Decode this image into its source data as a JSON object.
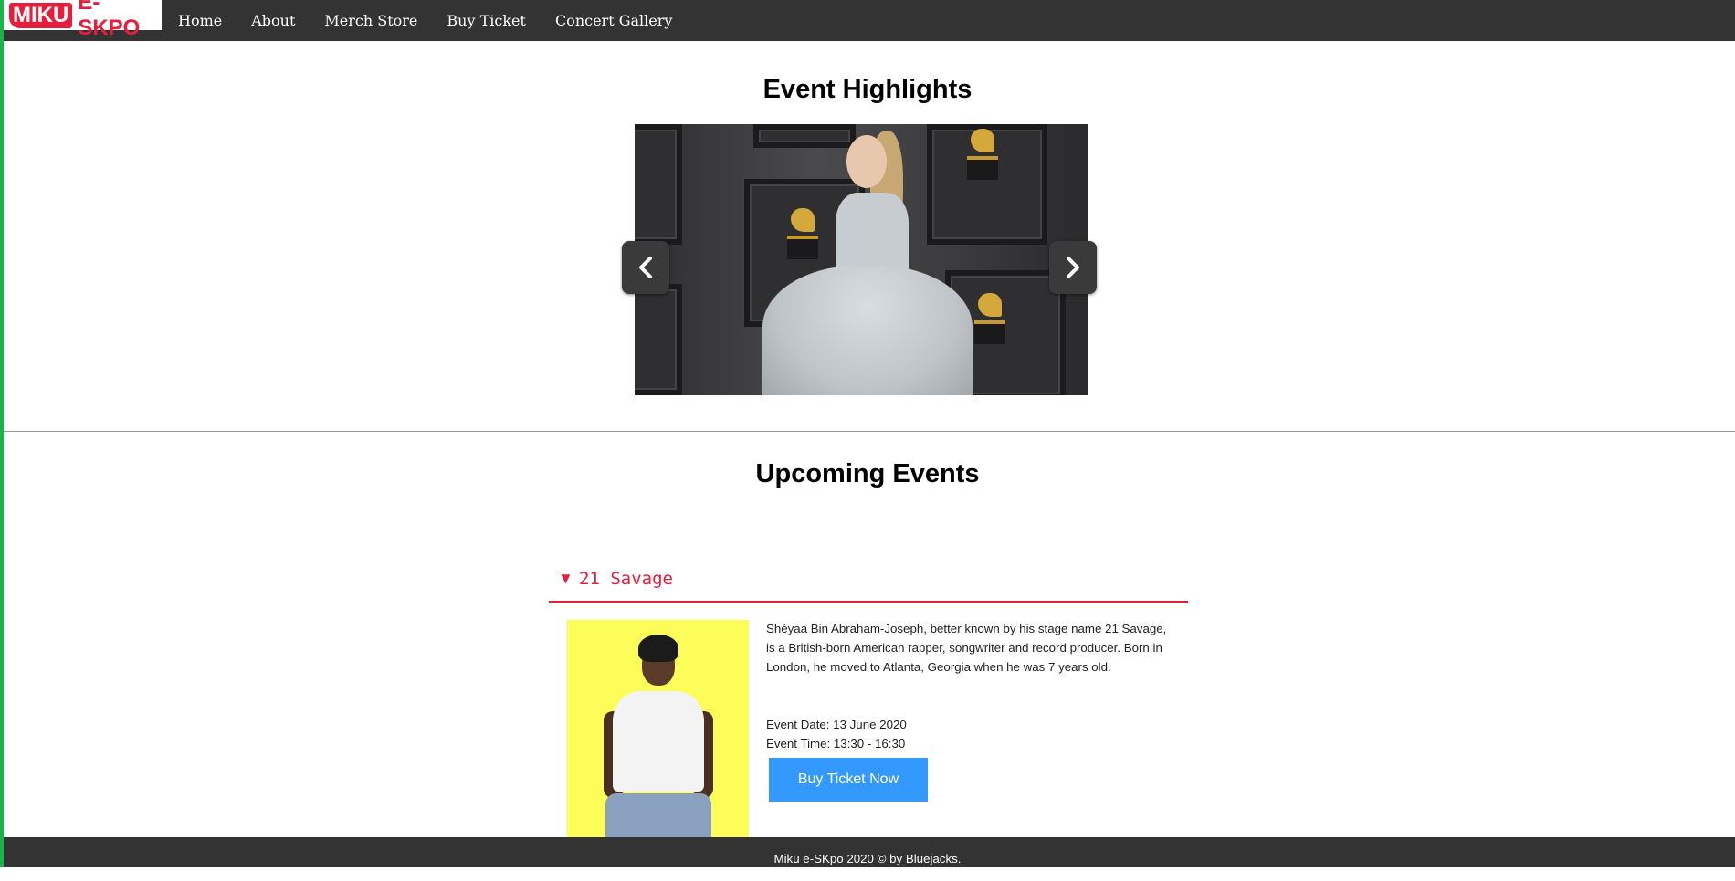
{
  "brand": {
    "logo_part1": "MIKU",
    "logo_part2": "E-SKPO"
  },
  "nav": {
    "items": [
      "Home",
      "About",
      "Merch Store",
      "Buy Ticket",
      "Concert Gallery"
    ]
  },
  "highlights": {
    "title": "Event Highlights"
  },
  "upcoming": {
    "title": "Upcoming Events",
    "event": {
      "name": "21 Savage",
      "description": "Shéyaa Bin Abraham-Joseph, better known by his stage name 21 Savage, is a British-born American rapper, songwriter and record producer. Born in London, he moved to Atlanta, Georgia when he was 7 years old.",
      "date": "Event Date: 13 June 2020",
      "time": "Event Time: 13:30 - 16:30",
      "button_label": "Buy Ticket Now"
    }
  },
  "footer": {
    "text": "Miku e-SKpo 2020 © by Bluejacks."
  },
  "colors": {
    "accent": "#e61e3c",
    "nav_bg": "#333333",
    "button": "#3399ff",
    "photo_bg": "#fdfd5a"
  }
}
